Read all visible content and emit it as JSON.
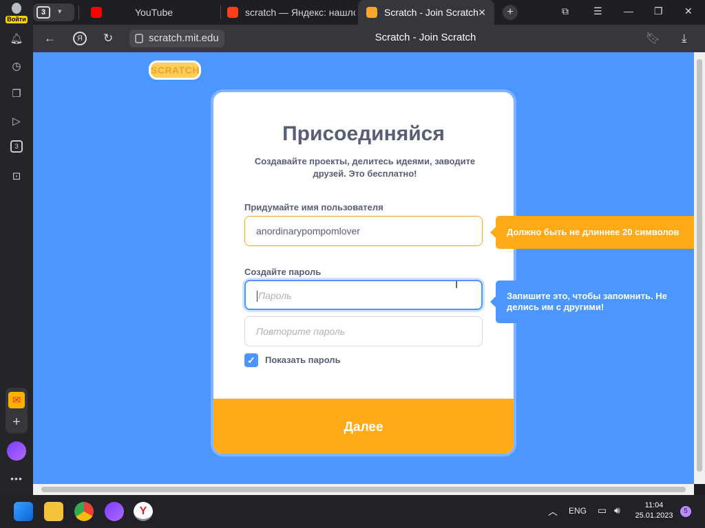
{
  "browser": {
    "profile_label": "Войти",
    "tab_group_count": "3",
    "tabs": [
      {
        "label": "YouTube"
      },
      {
        "label": "scratch — Яндекс: нашло"
      },
      {
        "label": "Scratch - Join Scratch"
      }
    ],
    "url": "scratch.mit.edu",
    "page_title": "Scratch - Join Scratch",
    "sidebar_badge": "3"
  },
  "page": {
    "logo_text": "SCRATCH",
    "heading": "Присоединяйся",
    "subtitle": "Создавайте проекты, делитесь идеями, заводите друзей. Это бесплатно!",
    "username": {
      "label": "Придумайте имя пользователя",
      "value": "anordinarypompomlover",
      "tooltip": "Должно быть не длиннее 20 символов"
    },
    "password": {
      "label": "Создайте пароль",
      "placeholder": "Пароль",
      "repeat_placeholder": "Повторите пароль",
      "tooltip": "Запишите это, чтобы запомнить. Не делись им с другими!"
    },
    "show_password": {
      "label": "Показать пароль",
      "checked": true
    },
    "next_button": "Далее"
  },
  "taskbar": {
    "lang": "ENG",
    "time": "11:04",
    "date": "25.01.2023",
    "notifications": "5"
  },
  "colors": {
    "page_bg": "#4c97ff",
    "accent_orange": "#ffab19",
    "text": "#575e75"
  }
}
